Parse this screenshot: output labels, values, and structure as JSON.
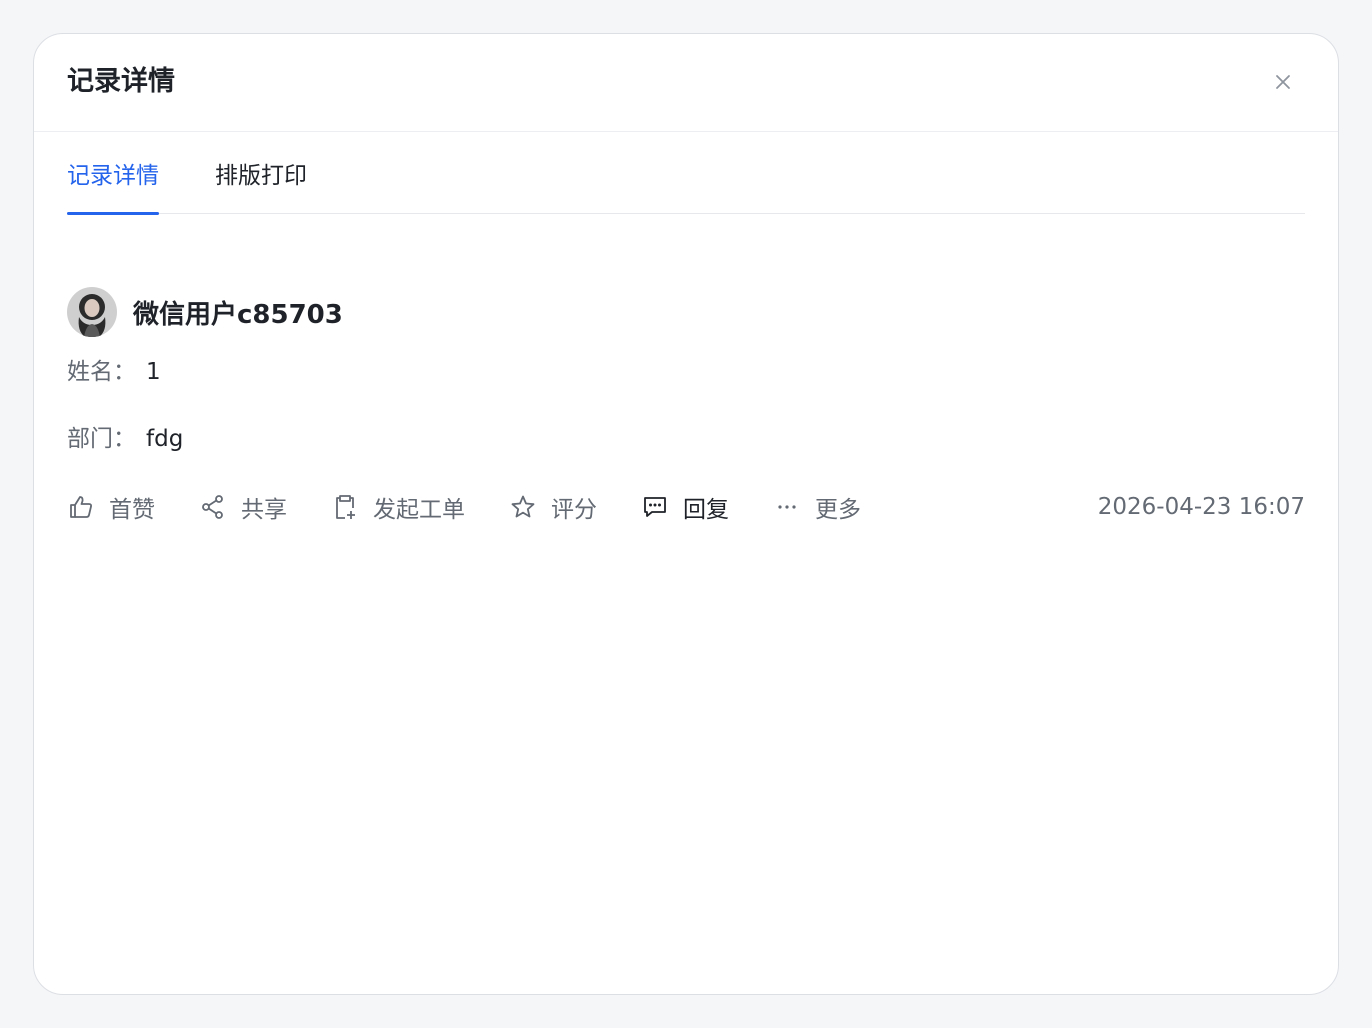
{
  "dialog": {
    "title": "记录详情"
  },
  "tabs": [
    {
      "label": "记录详情",
      "active": true
    },
    {
      "label": "排版打印",
      "active": false
    }
  ],
  "record": {
    "user_name": "微信用户c85703",
    "fields": {
      "name_label": "姓名：",
      "name_value": "1",
      "dept_label": "部门：",
      "dept_value": "fdg"
    },
    "actions": {
      "like": "首赞",
      "share": "共享",
      "work_order": "发起工单",
      "rate": "评分",
      "reply": "回复",
      "more": "更多"
    },
    "timestamp": "2026-04-23 16:07"
  },
  "colors": {
    "accent": "#2463eb",
    "text_primary": "#1f2329",
    "text_secondary": "#646a73"
  },
  "icons": {
    "close": "close-icon",
    "like": "thumbs-up-icon",
    "share": "share-icon",
    "work_order": "clipboard-add-icon",
    "rate": "star-icon",
    "reply": "comment-icon",
    "more": "ellipsis-icon"
  }
}
